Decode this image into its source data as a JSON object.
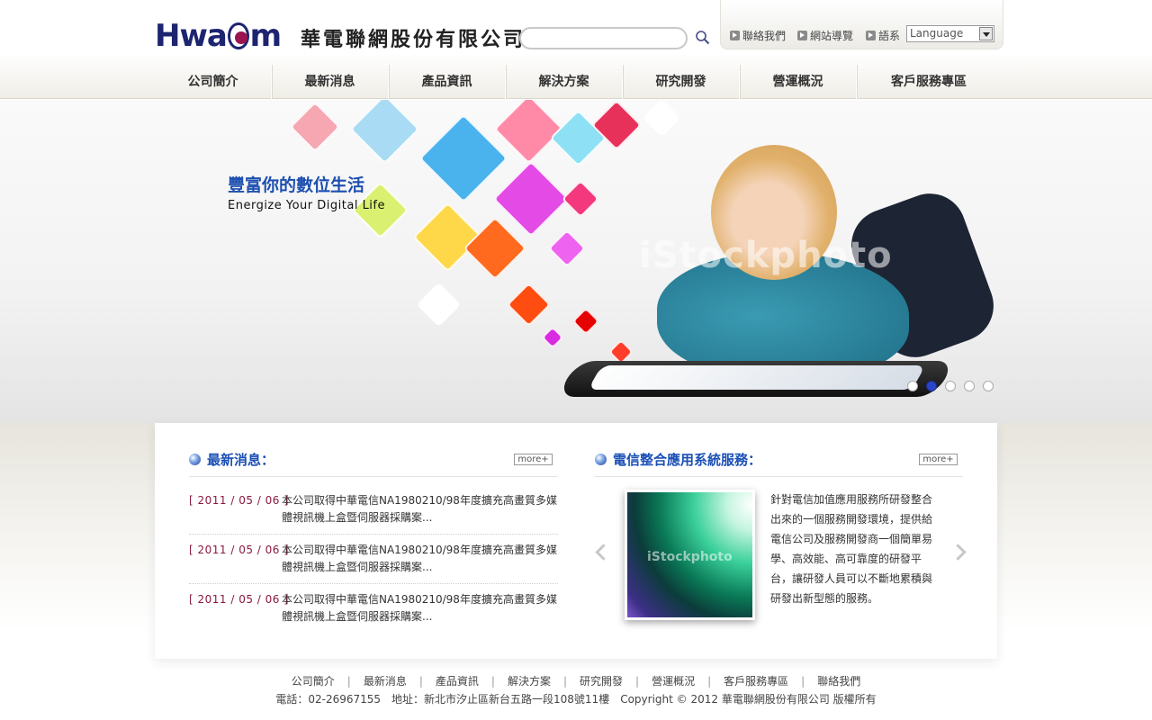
{
  "header": {
    "logo_text": "Hwacom",
    "company_name": "華電聯網股份有限公司",
    "search": {
      "placeholder": ""
    },
    "util_links": [
      "聯絡我們",
      "網站導覽",
      "語系"
    ],
    "language_select": "Language"
  },
  "nav": {
    "items": [
      "公司簡介",
      "最新消息",
      "產品資訊",
      "解決方案",
      "研究開發",
      "營運概況",
      "客戶服務專區"
    ]
  },
  "banner": {
    "title": "豐富你的數位生活",
    "subtitle": "Energize Your Digital Life",
    "watermark": "iStockphoto",
    "slide_count": 5,
    "active_slide": 2
  },
  "news": {
    "title": "最新消息：",
    "more_label": "more+",
    "items": [
      {
        "date": "[ 2011 / 05 / 06 ]",
        "text": "本公司取得中華電信NA1980210/98年度擴充高畫質多媒體視訊機上盒暨伺服器採購案..."
      },
      {
        "date": "[ 2011 / 05 / 06 ]",
        "text": "本公司取得中華電信NA1980210/98年度擴充高畫質多媒體視訊機上盒暨伺服器採購案..."
      },
      {
        "date": "[ 2011 / 05 / 06 ]",
        "text": "本公司取得中華電信NA1980210/98年度擴充高畫質多媒體視訊機上盒暨伺服器採購案..."
      }
    ]
  },
  "service": {
    "title": "電信整合應用系統服務：",
    "more_label": "more+",
    "image_watermark": "iStockphoto",
    "description": "針對電信加值應用服務所研發整合出來的一個服務開發環境，提供給電信公司及服務開發商一個簡單易學、高效能、高可靠度的研發平台，讓研發人員可以不斷地累積與研發出新型態的服務。"
  },
  "footer": {
    "links": [
      "公司簡介",
      "最新消息",
      "產品資訊",
      "解決方案",
      "研究開發",
      "營運概況",
      "客戶服務專區",
      "聯絡我們"
    ],
    "info": "電話：02-26967155　地址：新北市汐止區新台五路一段108號11樓　Copyright © 2012 華電聯網股份有限公司 版權所有"
  },
  "colors": {
    "brand_navy": "#1d2470",
    "brand_magenta": "#9b1450",
    "accent_blue": "#1a4fb5",
    "date_red": "#8a1a3d"
  }
}
